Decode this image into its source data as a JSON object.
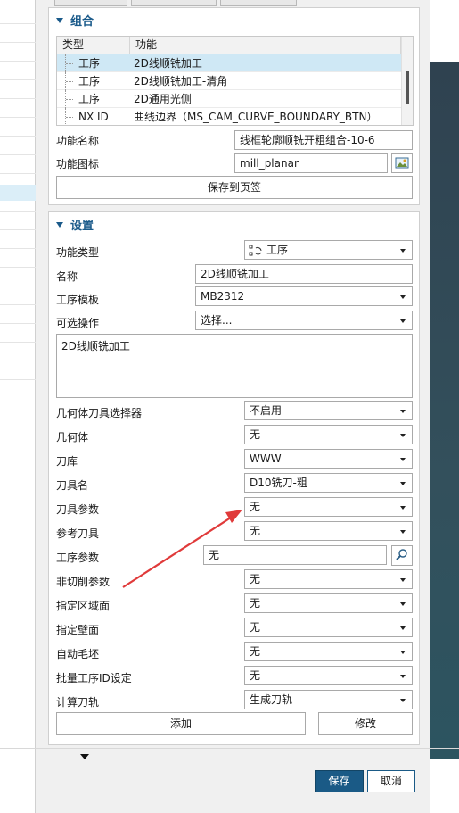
{
  "combo_section": {
    "title": "组合",
    "table": {
      "headers": [
        "类型",
        "功能"
      ],
      "rows": [
        {
          "type": "工序",
          "func": "2D线顺铣加工"
        },
        {
          "type": "工序",
          "func": "2D线顺铣加工-清角"
        },
        {
          "type": "工序",
          "func": "2D通用光侧"
        },
        {
          "type": "NX ID",
          "func": "曲线边界（MS_CAM_CURVE_BOUNDARY_BTN）"
        }
      ]
    },
    "func_name_label": "功能名称",
    "func_name_value": "线框轮廓顺铣开粗组合-10-6",
    "func_icon_label": "功能图标",
    "func_icon_value": "mill_planar",
    "save_to_tab_label": "保存到页签"
  },
  "settings_section": {
    "title": "设置",
    "func_type_label": "功能类型",
    "func_type_value": "工序",
    "name_label": "名称",
    "name_value": "2D线顺铣加工",
    "template_label": "工序模板",
    "template_value": "MB2312",
    "optional_op_label": "可选操作",
    "optional_op_value": "选择...",
    "description_text": "2D线顺铣加工",
    "fields": [
      {
        "label": "几何体刀具选择器",
        "value": "不启用"
      },
      {
        "label": "几何体",
        "value": "无"
      },
      {
        "label": "刀库",
        "value": "WWW"
      },
      {
        "label": "刀具名",
        "value": "D10铣刀-粗"
      },
      {
        "label": "刀具参数",
        "value": "无"
      },
      {
        "label": "参考刀具",
        "value": "无"
      }
    ],
    "op_param_label": "工序参数",
    "op_param_value": "无",
    "fields2": [
      {
        "label": "非切削参数",
        "value": "无"
      },
      {
        "label": "指定区域面",
        "value": "无"
      },
      {
        "label": "指定壁面",
        "value": "无"
      },
      {
        "label": "自动毛坯",
        "value": "无"
      },
      {
        "label": "批量工序ID设定",
        "value": "无"
      },
      {
        "label": "计算刀轨",
        "value": "生成刀轨"
      }
    ],
    "add_label": "添加",
    "modify_label": "修改"
  },
  "footer": {
    "save_label": "保存",
    "cancel_label": "取消"
  },
  "colors": {
    "accent": "#1a5a86",
    "annotation_arrow": "#e03a3a",
    "selected_row": "#cfe8f5"
  }
}
